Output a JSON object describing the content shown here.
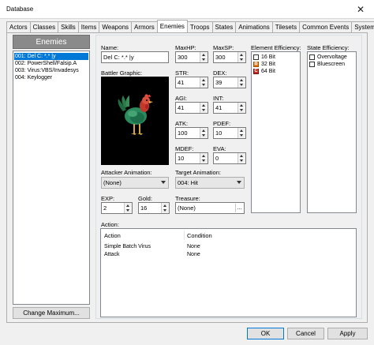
{
  "window": {
    "title": "Database",
    "close_glyph": "✕"
  },
  "tabs": [
    {
      "label": "Actors"
    },
    {
      "label": "Classes"
    },
    {
      "label": "Skills"
    },
    {
      "label": "Items"
    },
    {
      "label": "Weapons"
    },
    {
      "label": "Armors"
    },
    {
      "label": "Enemies"
    },
    {
      "label": "Troops"
    },
    {
      "label": "States"
    },
    {
      "label": "Animations"
    },
    {
      "label": "Tilesets"
    },
    {
      "label": "Common Events"
    },
    {
      "label": "System"
    }
  ],
  "active_tab": "Enemies",
  "enemy_list": {
    "header": "Enemies",
    "items": [
      "001: Del C: *.* |y",
      "002: PowerShell/Falsip.A",
      "003: Virus:VBS/Invadesys",
      "004: Keylogger"
    ],
    "selected_index": 0,
    "change_max_label": "Change Maximum..."
  },
  "enemy": {
    "name_label": "Name:",
    "name_value": "Del C: *.* |y",
    "battler_label": "Battler Graphic:",
    "maxhp": {
      "label": "MaxHP:",
      "value": "300"
    },
    "maxsp": {
      "label": "MaxSP:",
      "value": "300"
    },
    "str": {
      "label": "STR:",
      "value": "41"
    },
    "dex": {
      "label": "DEX:",
      "value": "39"
    },
    "agi": {
      "label": "AGI:",
      "value": "41"
    },
    "int": {
      "label": "INT:",
      "value": "41"
    },
    "atk": {
      "label": "ATK:",
      "value": "100"
    },
    "pdef": {
      "label": "PDEF:",
      "value": "10"
    },
    "mdef": {
      "label": "MDEF:",
      "value": "10"
    },
    "eva": {
      "label": "EVA:",
      "value": "0"
    },
    "attacker_anim": {
      "label": "Attacker Animation:",
      "value": "(None)"
    },
    "target_anim": {
      "label": "Target Animation:",
      "value": "004: Hit"
    },
    "exp": {
      "label": "EXP:",
      "value": "2"
    },
    "gold": {
      "label": "Gold:",
      "value": "16"
    },
    "treasure": {
      "label": "Treasure:",
      "value": "(None)",
      "button": "..."
    }
  },
  "element_efficiency": {
    "label": "Element Efficiency:",
    "items": [
      {
        "label": "16 Bit",
        "state": "none"
      },
      {
        "label": "32 Bit",
        "state": "orange"
      },
      {
        "label": "64 Bit",
        "state": "red"
      }
    ]
  },
  "state_efficiency": {
    "label": "State Efficiency:",
    "items": [
      {
        "label": "Overvoltage"
      },
      {
        "label": "Bluescreen"
      }
    ]
  },
  "action": {
    "label": "Action:",
    "headers": {
      "action": "Action",
      "condition": "Condition"
    },
    "rows": [
      {
        "action": "Simple Batch Virus",
        "condition": "None"
      },
      {
        "action": "Attack",
        "condition": "None"
      }
    ]
  },
  "buttons": {
    "ok": "OK",
    "cancel": "Cancel",
    "apply": "Apply"
  },
  "colors": {
    "selection": "#0078d7",
    "list_header": "#8a8a8a"
  }
}
